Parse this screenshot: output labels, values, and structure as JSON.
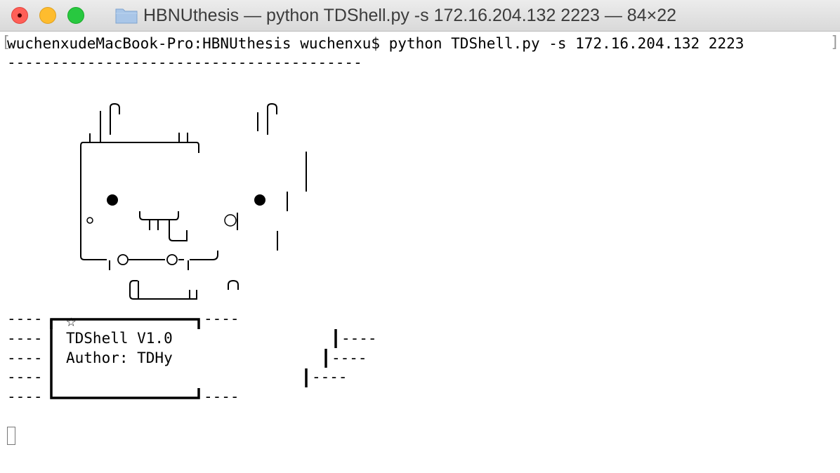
{
  "window": {
    "title": "HBNUthesis — python TDShell.py -s 172.16.204.132 2223 — 84×22"
  },
  "terminal": {
    "command_line": "wuchenxudeMacBook-Pro:HBNUthesis wuchenxu$ python TDShell.py -s 172.16.204.132 2223",
    "dash_line": "----------------------------------------",
    "side_dashes": "----",
    "banner": {
      "line1": "TDShell V1.0",
      "line2": "Author: TDHy"
    },
    "star": "☆"
  }
}
